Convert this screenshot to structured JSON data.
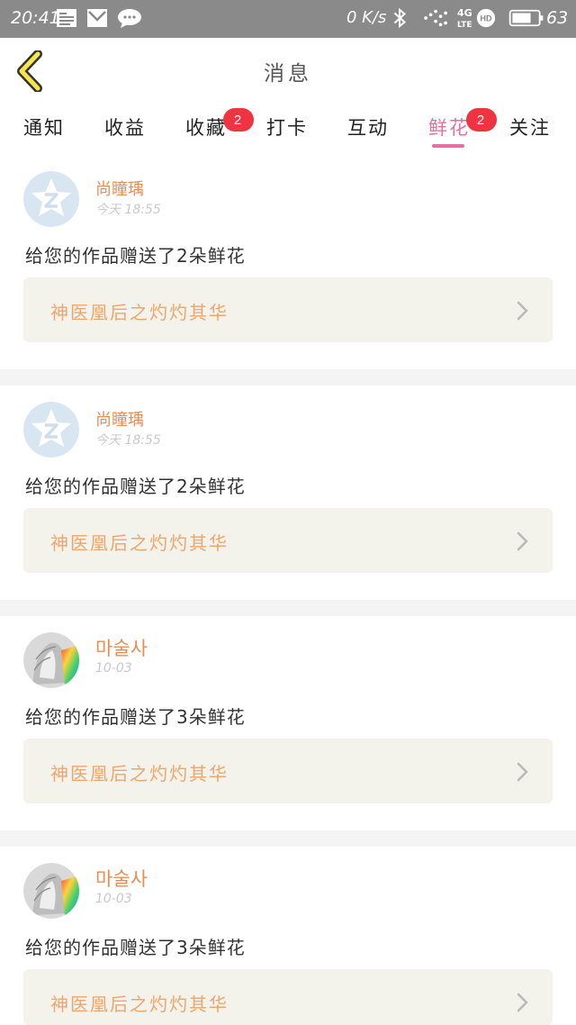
{
  "status_bar": {
    "time": "20:41",
    "speed": "0 K/s",
    "network": "4G",
    "battery": "63",
    "icons": [
      "notes-icon",
      "mail-icon",
      "chat-icon",
      "bluetooth-icon",
      "signal-icon",
      "hd-icon",
      "battery-icon"
    ]
  },
  "header": {
    "title": "消息",
    "back_icon": "chevron-left-icon"
  },
  "tabs": [
    {
      "label": "通知",
      "badge": ""
    },
    {
      "label": "收益",
      "badge": ""
    },
    {
      "label": "收藏",
      "badge": "2"
    },
    {
      "label": "打卡",
      "badge": ""
    },
    {
      "label": "互动",
      "badge": ""
    },
    {
      "label": "鲜花",
      "badge": "2",
      "active": true
    },
    {
      "label": "关注",
      "badge": ""
    }
  ],
  "messages": [
    {
      "user": "尚瞳瑀",
      "time": "今天 18:55",
      "text": "给您的作品赠送了2朵鲜花",
      "book": "神医凰后之灼灼其华",
      "avatar": "default-avatar"
    },
    {
      "user": "尚瞳瑀",
      "time": "今天 18:55",
      "text": "给您的作品赠送了2朵鲜花",
      "book": "神医凰后之灼灼其华",
      "avatar": "default-avatar"
    },
    {
      "user": "마술사",
      "time": "10-03",
      "text": "给您的作品赠送了3朵鲜花",
      "book": "神医凰后之灼灼其华",
      "avatar": "illustration-avatar"
    },
    {
      "user": "마술사",
      "time": "10-03",
      "text": "给您的作品赠送了3朵鲜花",
      "book": "神医凰后之灼灼其华",
      "avatar": "illustration-avatar"
    }
  ],
  "colors": {
    "accent": "#e46fa0",
    "username": "#e98d55",
    "book_title": "#f0a56a",
    "badge": "#ef3340",
    "status_bar": "#8a8a8a"
  }
}
